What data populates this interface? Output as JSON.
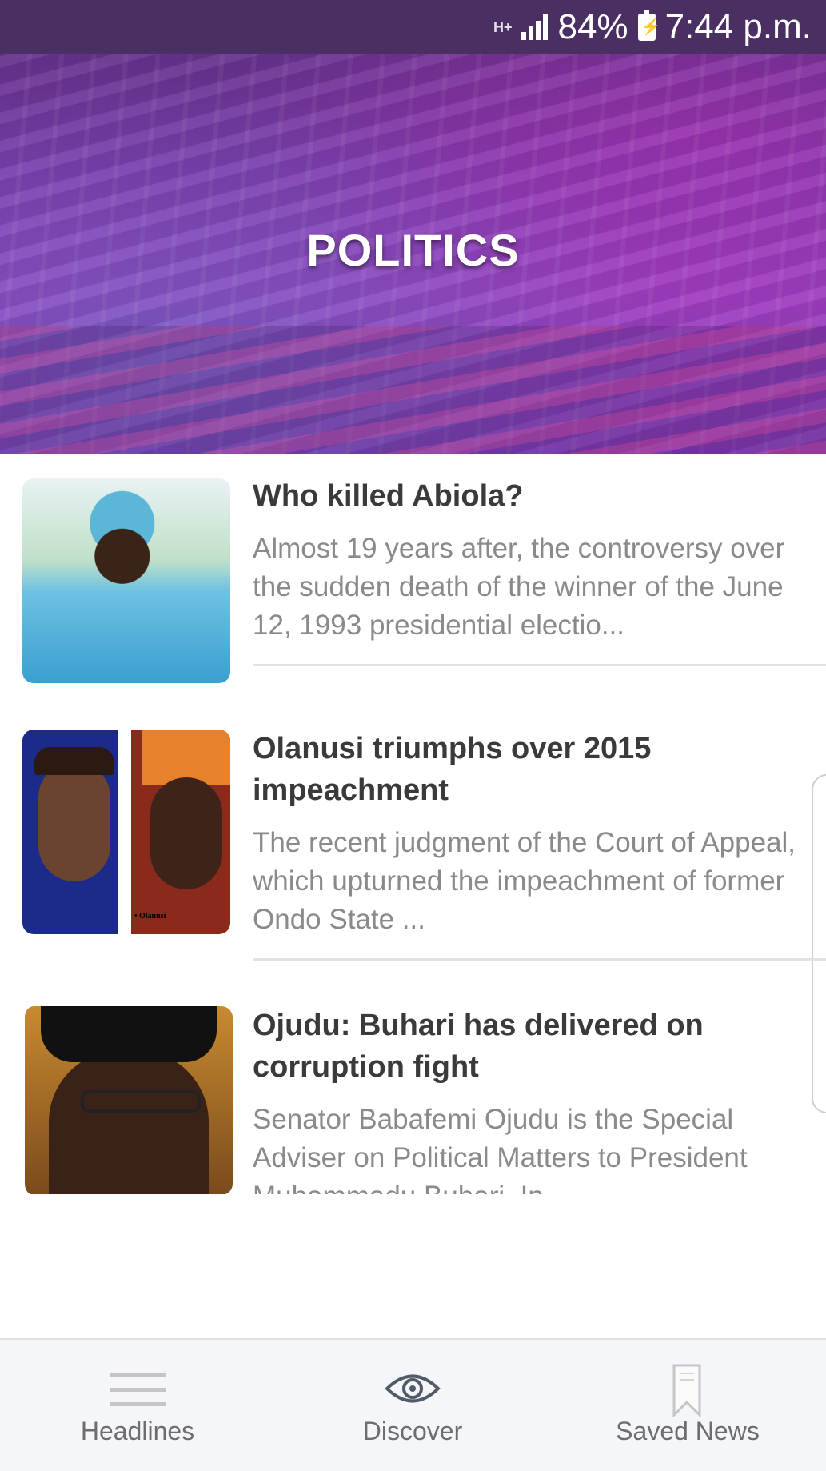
{
  "status_bar": {
    "network": "H+",
    "battery_percent": "84%",
    "time": "7:44 p.m."
  },
  "header": {
    "title": "POLITICS"
  },
  "articles": [
    {
      "title": "Who killed Abiola?",
      "summary": "Almost 19 years after, the controversy over the sudden death of the winner of the June 12, 1993 presidential electio..."
    },
    {
      "title": "Olanusi triumphs over 2015 impeachment",
      "summary": "The recent judgment of the Court of Appeal, which upturned the impeachment of former Ondo State ...",
      "image_caption": "• Olanusi"
    },
    {
      "title": "Ojudu: Buhari has delivered on corruption fight",
      "summary": "Senator Babafemi Ojudu is the Special Adviser on Political Matters to President Muhammadu Buhari. In"
    }
  ],
  "bottom_nav": {
    "items": [
      {
        "label": "Headlines",
        "icon": "menu-icon"
      },
      {
        "label": "Discover",
        "icon": "eye-icon"
      },
      {
        "label": "Saved News",
        "icon": "bookmark-icon"
      }
    ]
  },
  "colors": {
    "banner_accent": "#8b3ab8",
    "title_text": "#3a3a3a",
    "summary_text": "#8a8a8a",
    "nav_background": "#f4f6fa"
  }
}
